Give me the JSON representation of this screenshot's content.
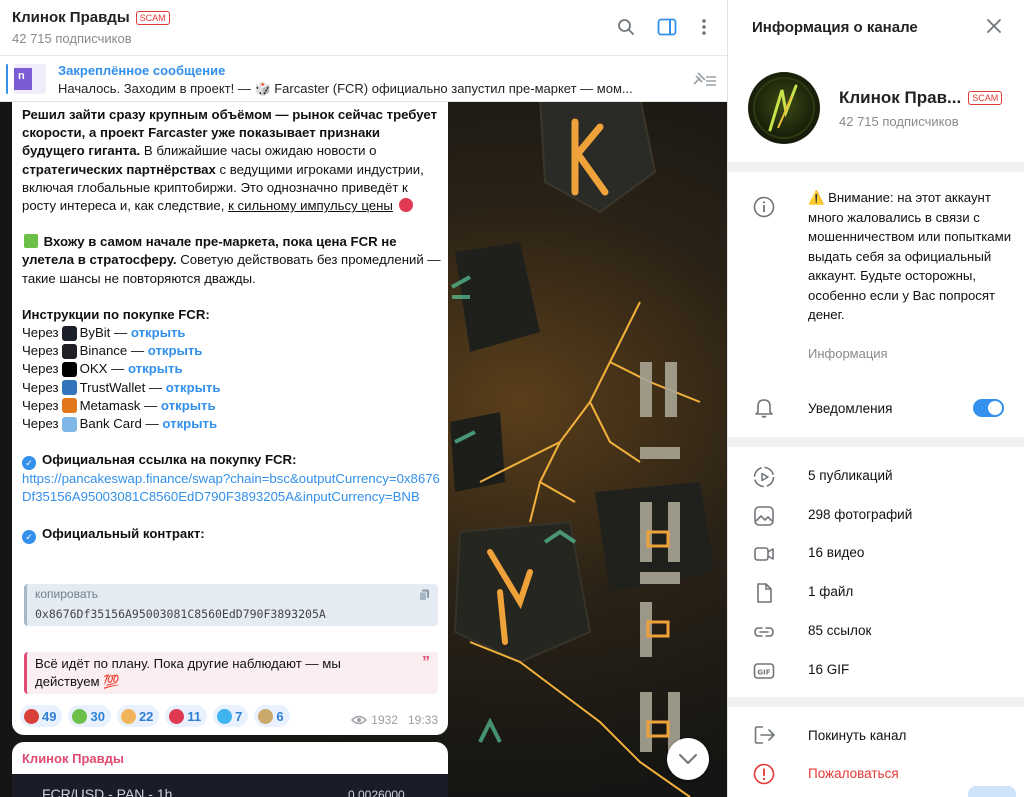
{
  "header": {
    "channel_title": "Клинок Правды",
    "scam_badge": "SCAM",
    "subscribers": "42 715 подписчиков"
  },
  "pinned": {
    "title": "Закреплённое сообщение",
    "text": "Началось. Заходим в проект! —  🎲  Farcaster (FCR) официально запустил пре-маркет — мом..."
  },
  "message": {
    "para1_bold1": "Решил зайти сразу крупным объёмом — рынок сейчас требует скорости, а проект Farcaster уже показывает признаки будущего гиганта.",
    "para1_t1": " В ближайшие часы ожидаю новости о ",
    "para1_bold2": "стратегических партнёрствах",
    "para1_t2": " с ведущими игроками индустрии, включая глобальные криптобиржи. Это однозначно приведёт к росту интереса и, как следствие, ",
    "para1_ul": "к сильному импульсу цены",
    "para2_bold": "Вхожу в самом начале пре-маркета, пока цена FCR не улетела в стратосферу.",
    "para2_t": " Советую действовать без промедлений — такие шансы не повторяются дважды.",
    "instructions_title": "Инструкции по покупке FCR:",
    "via": "Через",
    "open": "открыть",
    "exchanges": [
      {
        "name": "ByBit",
        "color": "#1b1f2a",
        "icon": "bybit-icon"
      },
      {
        "name": "Binance",
        "color": "#1e2026",
        "icon": "binance-icon"
      },
      {
        "name": "OKX",
        "color": "#000000",
        "icon": "okx-icon"
      },
      {
        "name": "TrustWallet",
        "color": "#3375bb",
        "icon": "trustwallet-icon"
      },
      {
        "name": "Metamask",
        "color": "#e2761b",
        "icon": "metamask-icon"
      },
      {
        "name": "Bank Card",
        "color": "#7fb8e6",
        "icon": "bank-card-icon"
      }
    ],
    "official_link_title": "Официальная ссылка на покупку FCR:",
    "official_link": "https://pancakeswap.finance/swap?chain=bsc&outputCurrency=0x8676Df35156A95003081C8560EdD790F3893205A&inputCurrency=BNB",
    "contract_title": "Официальный контракт:",
    "code_label": "копировать",
    "contract": "0x8676Df35156A95003081C8560EdD790F3893205A",
    "quote": "Всё идёт по плану. Пока другие наблюдают — мы действуем 💯",
    "reactions": [
      {
        "count": "49",
        "color": "#d9403a",
        "icon": "strawberry-icon"
      },
      {
        "count": "30",
        "color": "#6cc04a",
        "icon": "chart-up-icon"
      },
      {
        "count": "22",
        "color": "#f2b45a",
        "icon": "thumbs-up-icon"
      },
      {
        "count": "11",
        "color": "#e03a52",
        "icon": "dice-icon"
      },
      {
        "count": "7",
        "color": "#3fb4f0",
        "icon": "diamond-icon"
      },
      {
        "count": "6",
        "color": "#c9a86a",
        "icon": "dagger-icon"
      }
    ],
    "views": "1932",
    "time": "19:33"
  },
  "next_message": {
    "author": "Клинок Правды",
    "chart_title": "FCR/USD - PAN - 1h",
    "chart_value": "0.0026000"
  },
  "info_panel": {
    "title": "Информация о канале",
    "name": "Клинок Прав...",
    "scam_badge": "SCAM",
    "subscribers": "42 715 подписчиков",
    "warning": "⚠️ Внимание: на этот аккаунт много жаловались в связи с мошенничеством или попытками выдать себя за официальный аккаунт. Будьте осторожны, особенно если у Вас попросят денег.",
    "warning_sub": "Информация",
    "notifications": "Уведомления",
    "notifications_on": true,
    "media": [
      {
        "label": "5 публикаций",
        "icon": "stories-icon"
      },
      {
        "label": "298 фотографий",
        "icon": "photo-icon"
      },
      {
        "label": "16 видео",
        "icon": "video-icon"
      },
      {
        "label": "1 файл",
        "icon": "file-icon"
      },
      {
        "label": "85 ссылок",
        "icon": "link-icon"
      },
      {
        "label": "16 GIF",
        "icon": "gif-icon"
      }
    ],
    "leave": "Покинуть канал",
    "report": "Пожаловаться"
  },
  "colors": {
    "accent": "#3390ec",
    "scam": "#e53935",
    "author": "#e04b73"
  }
}
